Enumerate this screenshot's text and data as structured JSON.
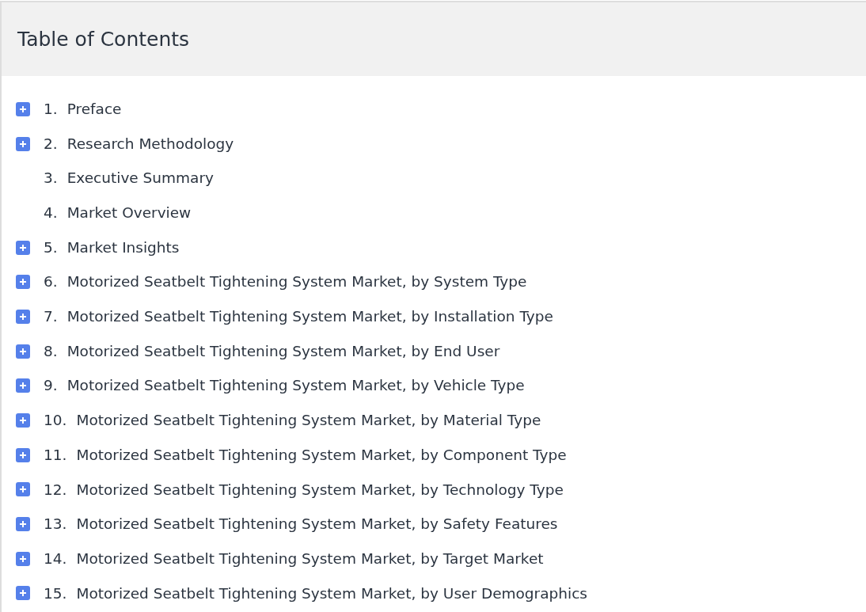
{
  "title": "Table of Contents",
  "items": [
    {
      "number": "1.",
      "label": "Preface",
      "expandable": true
    },
    {
      "number": "2.",
      "label": "Research Methodology",
      "expandable": true
    },
    {
      "number": "3.",
      "label": "Executive Summary",
      "expandable": false
    },
    {
      "number": "4.",
      "label": "Market Overview",
      "expandable": false
    },
    {
      "number": "5.",
      "label": "Market Insights",
      "expandable": true
    },
    {
      "number": "6.",
      "label": "Motorized Seatbelt Tightening System Market, by System Type",
      "expandable": true
    },
    {
      "number": "7.",
      "label": "Motorized Seatbelt Tightening System Market, by Installation Type",
      "expandable": true
    },
    {
      "number": "8.",
      "label": "Motorized Seatbelt Tightening System Market, by End User",
      "expandable": true
    },
    {
      "number": "9.",
      "label": "Motorized Seatbelt Tightening System Market, by Vehicle Type",
      "expandable": true
    },
    {
      "number": "10.",
      "label": "Motorized Seatbelt Tightening System Market, by Material Type",
      "expandable": true
    },
    {
      "number": "11.",
      "label": "Motorized Seatbelt Tightening System Market, by Component Type",
      "expandable": true
    },
    {
      "number": "12.",
      "label": "Motorized Seatbelt Tightening System Market, by Technology Type",
      "expandable": true
    },
    {
      "number": "13.",
      "label": "Motorized Seatbelt Tightening System Market, by Safety Features",
      "expandable": true
    },
    {
      "number": "14.",
      "label": "Motorized Seatbelt Tightening System Market, by Target Market",
      "expandable": true
    },
    {
      "number": "15.",
      "label": "Motorized Seatbelt Tightening System Market, by User Demographics",
      "expandable": true
    }
  ]
}
